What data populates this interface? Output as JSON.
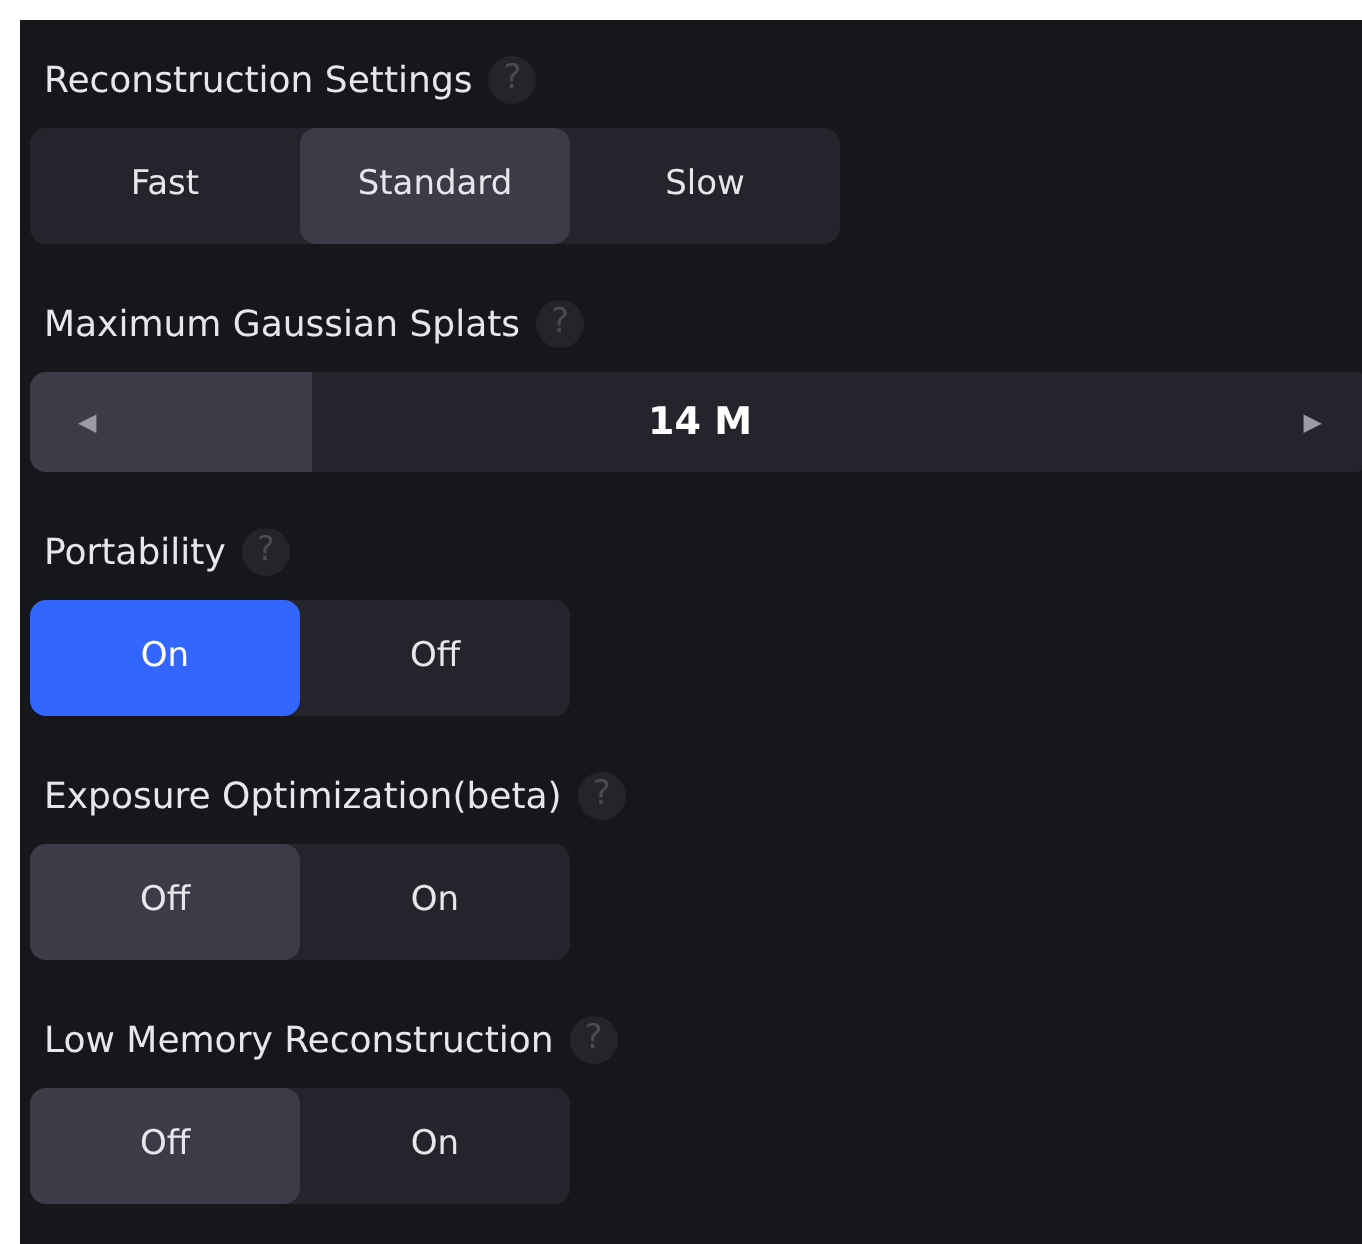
{
  "sections": [
    {
      "kind": "segmented",
      "title": "Reconstruction Settings",
      "accent": false,
      "options": [
        {
          "label": "Fast",
          "selected": false
        },
        {
          "label": "Standard",
          "selected": true
        },
        {
          "label": "Slow",
          "selected": false
        }
      ]
    },
    {
      "kind": "slider",
      "title": "Maximum Gaussian Splats",
      "value": "14 M",
      "level": 0.21,
      "left_arrow": "◀",
      "right_arrow": "▶"
    },
    {
      "kind": "segmented",
      "title": "Portability",
      "accent": true,
      "options": [
        {
          "label": "On",
          "selected": true
        },
        {
          "label": "Off",
          "selected": false
        }
      ]
    },
    {
      "kind": "segmented",
      "title": "Exposure Optimization(beta)",
      "accent": false,
      "options": [
        {
          "label": "Off",
          "selected": true
        },
        {
          "label": "On",
          "selected": false
        }
      ]
    },
    {
      "kind": "segmented",
      "title": "Low Memory Reconstruction",
      "accent": false,
      "options": [
        {
          "label": "Off",
          "selected": true
        },
        {
          "label": "On",
          "selected": false
        }
      ]
    }
  ],
  "help_mark": "?"
}
